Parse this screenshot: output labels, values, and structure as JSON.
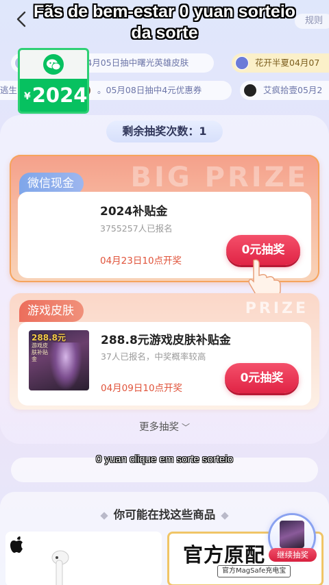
{
  "header": {
    "caption_title": "Fãs de bem-estar 0 yuan sorteio da sorte",
    "rules_label": "规则"
  },
  "ticker": {
    "row1": [
      {
        "text": "凯撒Caesar04月05日抽中曙光英雄皮肤"
      },
      {
        "text": "花开半夏04月07"
      }
    ],
    "row2": [
      {
        "text": "逃生 防弹衣"
      },
      {
        "text": "。05月08日抽中4元优惠券"
      },
      {
        "text": "艾疯拾壹05月2"
      }
    ]
  },
  "remaining": {
    "label": "剩余抽奖次数：1"
  },
  "prizes": [
    {
      "tag": "微信现金",
      "bg_text": "BIG PRIZE",
      "thumb_amount": "2024",
      "thumb_currency": "¥",
      "name": "2024补贴金",
      "count": "3755257人已报名",
      "date": "04月23日10点开奖",
      "button": "0元抽奖"
    },
    {
      "tag": "游戏皮肤",
      "bg_text": "PRIZE",
      "thumb_amount": "288.8元",
      "thumb_sub": "游戏皮肤补贴金",
      "name": "288.8元游戏皮肤补贴金",
      "count": "37人已报名，中奖概率较高",
      "date": "04月09日10点开奖",
      "button": "0元抽奖"
    }
  ],
  "more": {
    "label": "更多抽奖"
  },
  "caption_sub": "0 yuan clique em sorte sorteio",
  "recommend": {
    "title": "你可能在找这些商品",
    "products": [
      {
        "title": ""
      },
      {
        "title": "官方原配",
        "sub": "官方MagSafe充电宝"
      }
    ]
  },
  "float_badge": {
    "label": "继续抽奖"
  },
  "colors": {
    "accent_red": "#e02445",
    "wechat_green": "#07c160",
    "date_red": "#e0533a"
  }
}
